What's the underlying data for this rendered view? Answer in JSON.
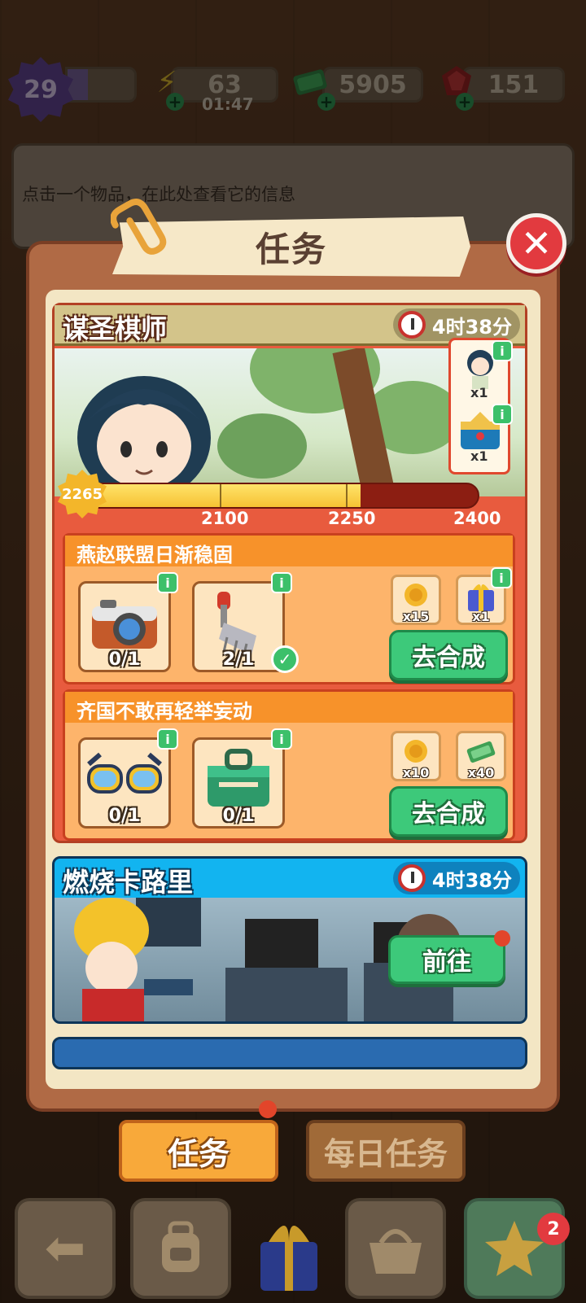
{
  "top_bar": {
    "level": "29",
    "level_progress": 0.3,
    "energy": "63",
    "energy_timer": "01:47",
    "cash": "5905",
    "gems": "151"
  },
  "info_panel": {
    "text": "点击一个物品，在此处查看它的信息"
  },
  "modal": {
    "title": "任务"
  },
  "quest1": {
    "title": "谋圣棋师",
    "timer": "4时38分",
    "rewards": [
      {
        "count": "x1"
      },
      {
        "count": "x1"
      }
    ],
    "score": "2265",
    "progress_value": 2265,
    "progress_max": 2400,
    "milestones": [
      "2100",
      "2250",
      "2400"
    ],
    "tasks": [
      {
        "title": "燕赵联盟日渐稳固",
        "items": [
          {
            "count": "0/1",
            "icon": "camera-icon"
          },
          {
            "count": "2/1",
            "icon": "rake-icon",
            "done": true
          }
        ],
        "rewards": [
          {
            "count": "x15",
            "icon": "coin-icon"
          },
          {
            "count": "x1",
            "icon": "gift-box-icon"
          }
        ],
        "button": "去合成"
      },
      {
        "title": "齐国不敢再轻举妄动",
        "items": [
          {
            "count": "0/1",
            "icon": "sunglasses-icon"
          },
          {
            "count": "0/1",
            "icon": "toolbox-icon"
          }
        ],
        "rewards": [
          {
            "count": "x10",
            "icon": "coin-icon"
          },
          {
            "count": "x40",
            "icon": "cash-icon"
          }
        ],
        "button": "去合成"
      }
    ]
  },
  "quest2": {
    "title": "燃烧卡路里",
    "timer": "4时38分",
    "button": "前往"
  },
  "tabs": {
    "active": "任务",
    "inactive": "每日任务"
  },
  "dock": {
    "star_badge": "2"
  },
  "colors": {
    "accent_orange": "#f8a93a",
    "green_button": "#3dc97a",
    "close_red": "#e23a3f",
    "quest_blue": "#12b4f0"
  }
}
